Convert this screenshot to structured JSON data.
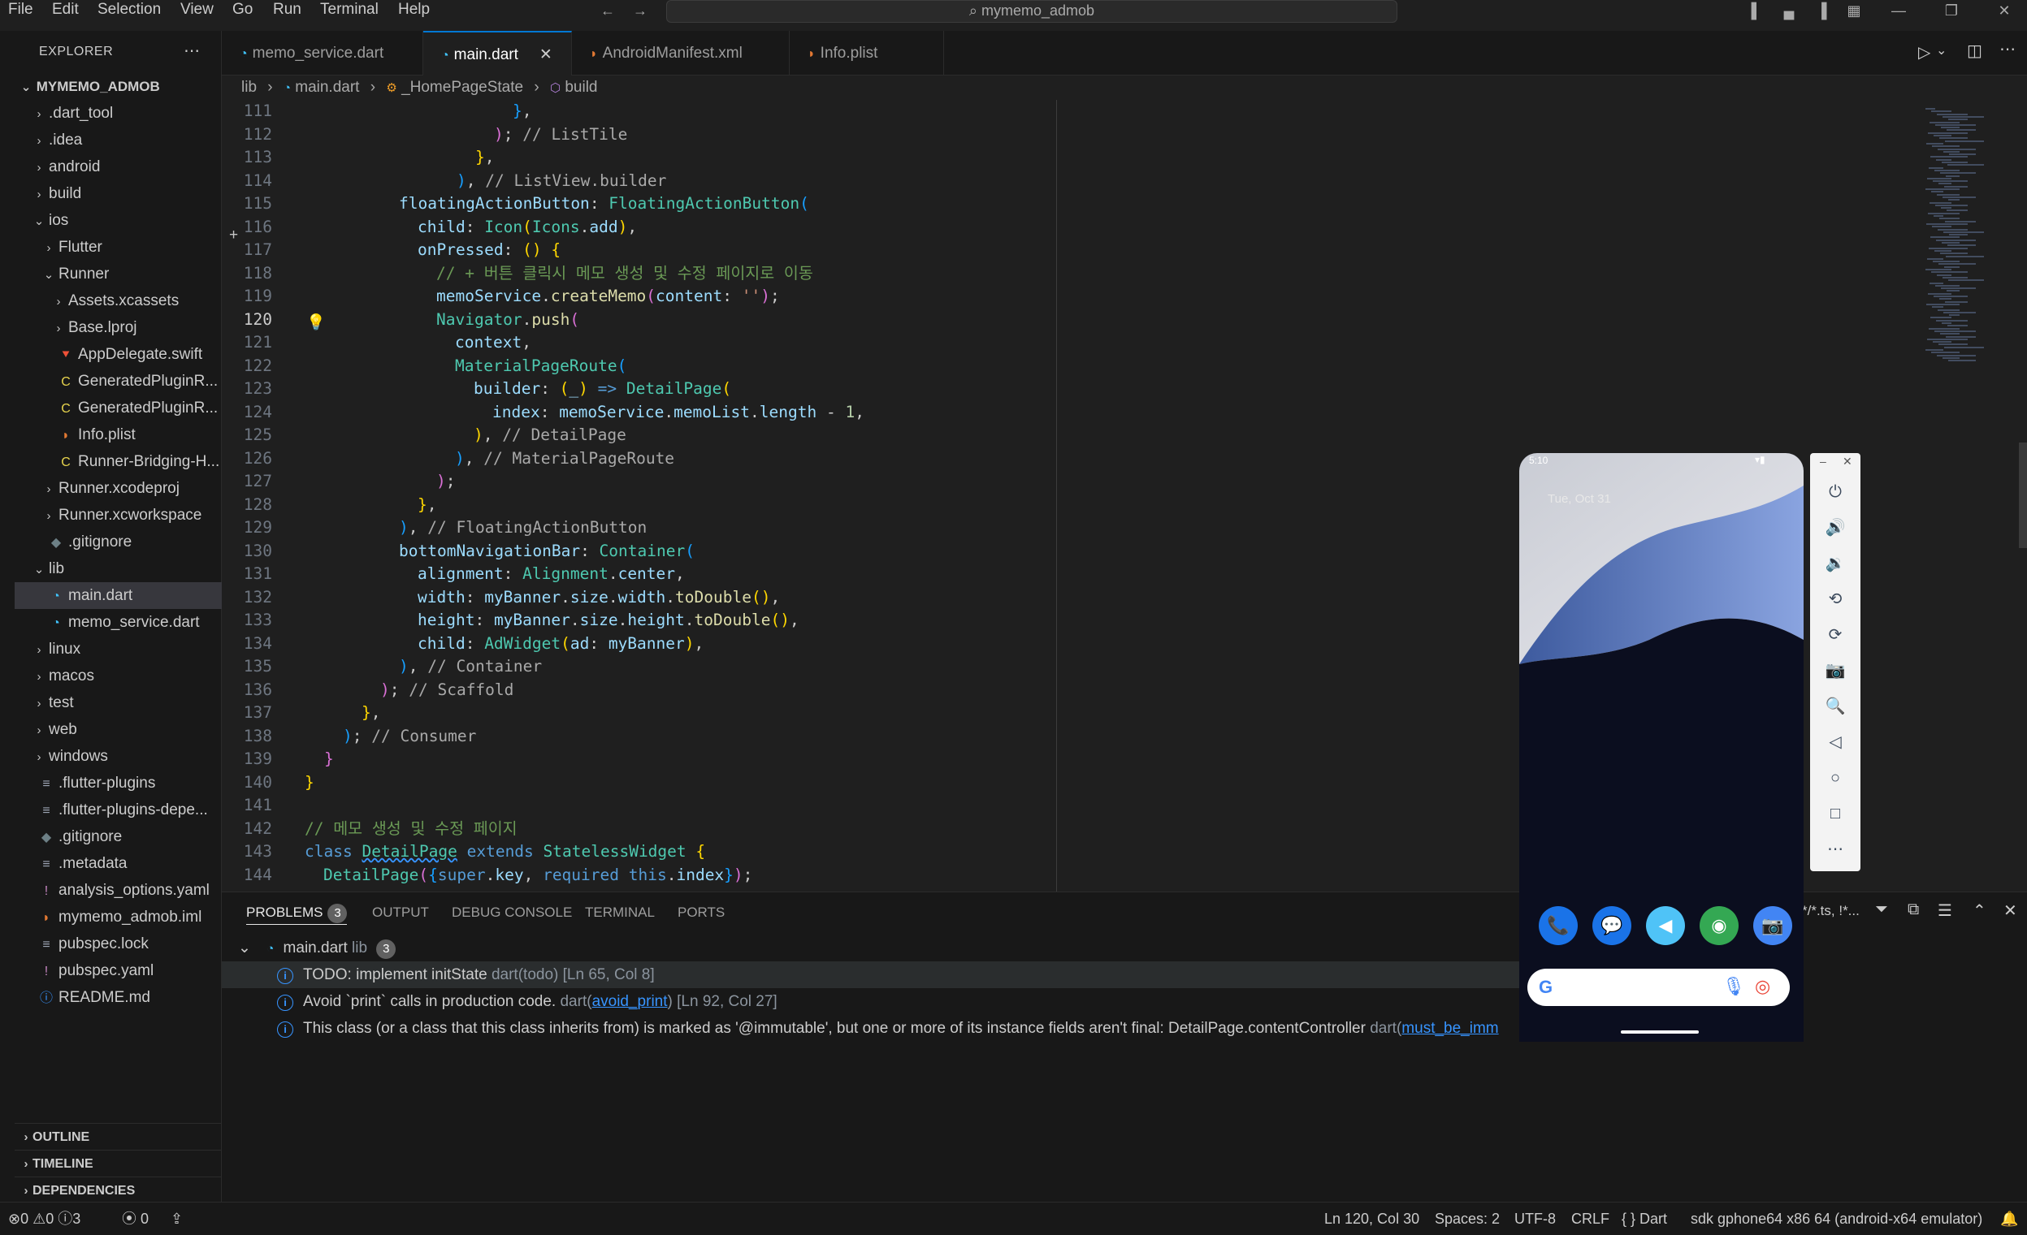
{
  "menu": [
    "File",
    "Edit",
    "Selection",
    "View",
    "Go",
    "Run",
    "Terminal",
    "Help"
  ],
  "search": "mymemo_admob",
  "sidebar": {
    "title": "EXPLORER",
    "root": "MYMEMO_ADMOB",
    "items": [
      {
        "label": ".dart_tool",
        "chev": "›",
        "icon": ""
      },
      {
        "label": ".idea",
        "chev": "›",
        "icon": ""
      },
      {
        "label": "android",
        "chev": "›",
        "icon": ""
      },
      {
        "label": "build",
        "chev": "›",
        "icon": ""
      },
      {
        "label": "ios",
        "chev": "⌄",
        "icon": ""
      },
      {
        "label": "Flutter",
        "chev": "›",
        "icon": ""
      },
      {
        "label": "Runner",
        "chev": "⌄",
        "icon": ""
      },
      {
        "label": "Assets.xcassets",
        "chev": "›",
        "icon": ""
      },
      {
        "label": "Base.lproj",
        "chev": "›",
        "icon": ""
      },
      {
        "label": "AppDelegate.swift",
        "chev": "",
        "icon": "swift"
      },
      {
        "label": "GeneratedPluginR...",
        "chev": "",
        "icon": "C"
      },
      {
        "label": "GeneratedPluginR...",
        "chev": "",
        "icon": "C"
      },
      {
        "label": "Info.plist",
        "chev": "",
        "icon": "rss"
      },
      {
        "label": "Runner-Bridging-H...",
        "chev": "",
        "icon": "C"
      },
      {
        "label": "Runner.xcodeproj",
        "chev": "›",
        "icon": ""
      },
      {
        "label": "Runner.xcworkspace",
        "chev": "›",
        "icon": ""
      },
      {
        "label": ".gitignore",
        "chev": "",
        "icon": "git"
      },
      {
        "label": "lib",
        "chev": "⌄",
        "icon": ""
      },
      {
        "label": "main.dart",
        "chev": "",
        "icon": "dart"
      },
      {
        "label": "memo_service.dart",
        "chev": "",
        "icon": "dart"
      },
      {
        "label": "linux",
        "chev": "›",
        "icon": ""
      },
      {
        "label": "macos",
        "chev": "›",
        "icon": ""
      },
      {
        "label": "test",
        "chev": "›",
        "icon": ""
      },
      {
        "label": "web",
        "chev": "›",
        "icon": ""
      },
      {
        "label": "windows",
        "chev": "›",
        "icon": ""
      },
      {
        "label": ".flutter-plugins",
        "chev": "",
        "icon": "lines"
      },
      {
        "label": ".flutter-plugins-depe...",
        "chev": "",
        "icon": "lines"
      },
      {
        "label": ".gitignore",
        "chev": "",
        "icon": "git"
      },
      {
        "label": ".metadata",
        "chev": "",
        "icon": "lines"
      },
      {
        "label": "analysis_options.yaml",
        "chev": "",
        "icon": "!"
      },
      {
        "label": "mymemo_admob.iml",
        "chev": "",
        "icon": "rss"
      },
      {
        "label": "pubspec.lock",
        "chev": "",
        "icon": "lines"
      },
      {
        "label": "pubspec.yaml",
        "chev": "",
        "icon": "!"
      },
      {
        "label": "README.md",
        "chev": "",
        "icon": "info"
      }
    ],
    "sections": [
      "OUTLINE",
      "TIMELINE",
      "DEPENDENCIES"
    ]
  },
  "tabs": [
    {
      "label": "memo_service.dart"
    },
    {
      "label": "main.dart"
    },
    {
      "label": "AndroidManifest.xml"
    },
    {
      "label": "Info.plist"
    }
  ],
  "breadcrumb": [
    "lib",
    "main.dart",
    "_HomePageState",
    "build"
  ],
  "code_lines": [
    111,
    112,
    113,
    114,
    115,
    116,
    117,
    118,
    119,
    120,
    121,
    122,
    123,
    124,
    125,
    126,
    127,
    128,
    129,
    130,
    131,
    132,
    133,
    134,
    135,
    136,
    137,
    138,
    139,
    140,
    141,
    142,
    143,
    144
  ],
  "code_text": {
    "l115a": "floatingActionButton",
    "l115b": "FloatingActionButton",
    "l116a": "child",
    "l116b": "Icon",
    "l116c": "Icons",
    "l116d": "add",
    "l117a": "onPressed",
    "l118": "// + 버튼 클릭시 메모 생성 및 수정 페이지로 이동",
    "l119a": "memoService",
    "l119b": "createMemo",
    "l119c": "content",
    "l119d": "''",
    "l120a": "Navigator",
    "l120b": "push",
    "l121": "context",
    "l122": "MaterialPageRoute",
    "l123a": "builder",
    "l123b": "DetailPage",
    "l124a": "index",
    "l124b": "memoService",
    "l124c": "memoList",
    "l124d": "length",
    "l124e": "1",
    "l125": "// DetailPage",
    "l126": "// MaterialPageRoute",
    "l129": "// FloatingActionButton",
    "l130a": "bottomNavigationBar",
    "l130b": "Container",
    "l131a": "alignment",
    "l131b": "Alignment",
    "l131c": "center",
    "l132a": "width",
    "l132b": "myBanner",
    "l132c": "size",
    "l132d": "width",
    "l132e": "toDouble",
    "l133a": "height",
    "l133b": "myBanner",
    "l133c": "size",
    "l133d": "height",
    "l133e": "toDouble",
    "l134a": "child",
    "l134b": "AdWidget",
    "l134c": "ad",
    "l134d": "myBanner",
    "l135": "// Container",
    "l136": "// Scaffold",
    "l138": "// Consumer",
    "l142": "// 메모 생성 및 수정 페이지",
    "l143a": "class",
    "l143b": "DetailPage",
    "l143c": "extends",
    "l143d": "StatelessWidget",
    "l144a": "DetailPage",
    "l144b": "super",
    "l144c": "key",
    "l144d": "required",
    "l144e": "this",
    "l144f": "index",
    "l112": "// ListTile",
    "l114": "// ListView.builder"
  },
  "panel": {
    "tabs": [
      "PROBLEMS",
      "OUTPUT",
      "DEBUG CONSOLE",
      "TERMINAL",
      "PORTS"
    ],
    "problem_count": "3",
    "filter_text": "*/*.ts, !*...",
    "group": {
      "file": "main.dart",
      "folder": "lib",
      "count": "3"
    },
    "problems": [
      {
        "msg": "TODO: implement initState",
        "src": "dart(todo)",
        "loc": "[Ln 65, Col 8]"
      },
      {
        "msg": "Avoid `print` calls in production code.",
        "src_pre": "dart(",
        "src_link": "avoid_print",
        "src_post": ")",
        "loc": "[Ln 92, Col 27]"
      },
      {
        "msg": "This class (or a class that this class inherits from) is marked as '@immutable', but one or more of its instance fields aren't final: DetailPage.contentController",
        "src_pre": "dart(",
        "src_link": "must_be_imm"
      }
    ]
  },
  "status": {
    "errors": "0",
    "warnings": "0",
    "infos": "3",
    "ports": "0",
    "position": "Ln 120, Col 30",
    "spaces": "Spaces: 2",
    "encoding": "UTF-8",
    "eol": "CRLF",
    "language": "Dart",
    "device": "sdk gphone64 x86 64 (android-x64 emulator)"
  },
  "emulator": {
    "time": "5:10",
    "date": "Tue, Oct 31",
    "apps": [
      {
        "name": "phone",
        "color": "#1a73e8"
      },
      {
        "name": "messages",
        "color": "#1a73e8"
      },
      {
        "name": "flutter",
        "color": "#4fc3f7"
      },
      {
        "name": "chrome",
        "color": "#34a853"
      },
      {
        "name": "camera",
        "color": "#4285f4"
      }
    ]
  },
  "colors": {
    "accent": "#0078d4",
    "info": "#3794ff",
    "editor_bg": "#1f1f1f",
    "sidebar_bg": "#181818"
  }
}
